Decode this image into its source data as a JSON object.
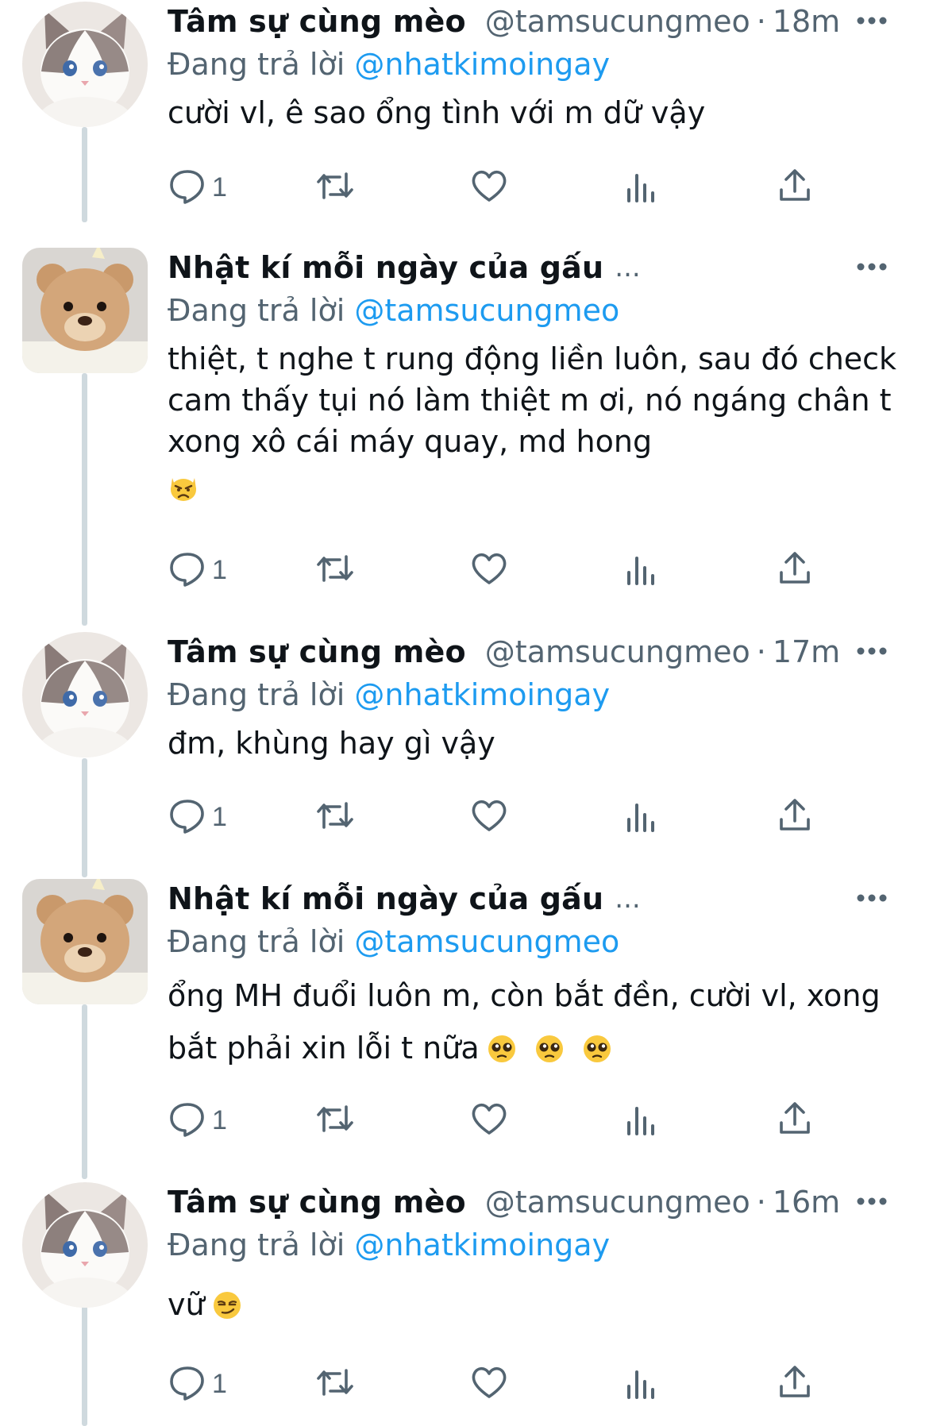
{
  "colors": {
    "link": "#1d9bf0",
    "secondary": "#536471",
    "thread_line": "#cfd9de"
  },
  "icons": {
    "reply": "reply-icon",
    "retweet": "retweet-icon",
    "like": "heart-icon",
    "views": "views-icon",
    "share": "share-icon",
    "more": "more-icon"
  },
  "tweets": [
    {
      "name": "Tâm sự cùng mèo",
      "handle": "@tamsucungmeo",
      "dot": "·",
      "time": "18m",
      "reply_prefix": "Đang trả lời ",
      "reply_to": "@nhatkimoingay",
      "text": "cười vl, ê sao ổng tình với m dữ vậy",
      "reply_count": "1",
      "avatar": "cat-avatar"
    },
    {
      "name": "Nhật kí mỗi ngày của gấu",
      "truncation": "...",
      "reply_prefix": "Đang trả lời ",
      "reply_to": "@tamsucungmeo",
      "text": "thiệt, t nghe t rung động liền luôn, sau đó check cam thấy tụi nó làm thiệt m ơi, nó ngáng chân t xong xô cái máy quay, md hong",
      "emojis": [
        "pouting-cat"
      ],
      "reply_count": "1",
      "avatar": "bear-avatar"
    },
    {
      "name": "Tâm sự cùng mèo",
      "handle": "@tamsucungmeo",
      "dot": "·",
      "time": "17m",
      "reply_prefix": "Đang trả lời ",
      "reply_to": "@nhatkimoingay",
      "text": "đm, khùng hay gì vậy",
      "reply_count": "1",
      "avatar": "cat-avatar"
    },
    {
      "name": "Nhật kí mỗi ngày của gấu",
      "truncation": "...",
      "reply_prefix": "Đang trả lời ",
      "reply_to": "@tamsucungmeo",
      "text": "ổng MH đuổi luôn m, còn bắt đền, cười vl, xong bắt phải xin lỗi t nữa",
      "emojis": [
        "pleading-face",
        "pleading-face",
        "pleading-face"
      ],
      "reply_count": "1",
      "avatar": "bear-avatar"
    },
    {
      "name": "Tâm sự cùng mèo",
      "handle": "@tamsucungmeo",
      "dot": "·",
      "time": "16m",
      "reply_prefix": "Đang trả lời ",
      "reply_to": "@nhatkimoingay",
      "text": "vữ",
      "emojis": [
        "smirking-face"
      ],
      "reply_count": "1",
      "avatar": "cat-avatar"
    }
  ]
}
